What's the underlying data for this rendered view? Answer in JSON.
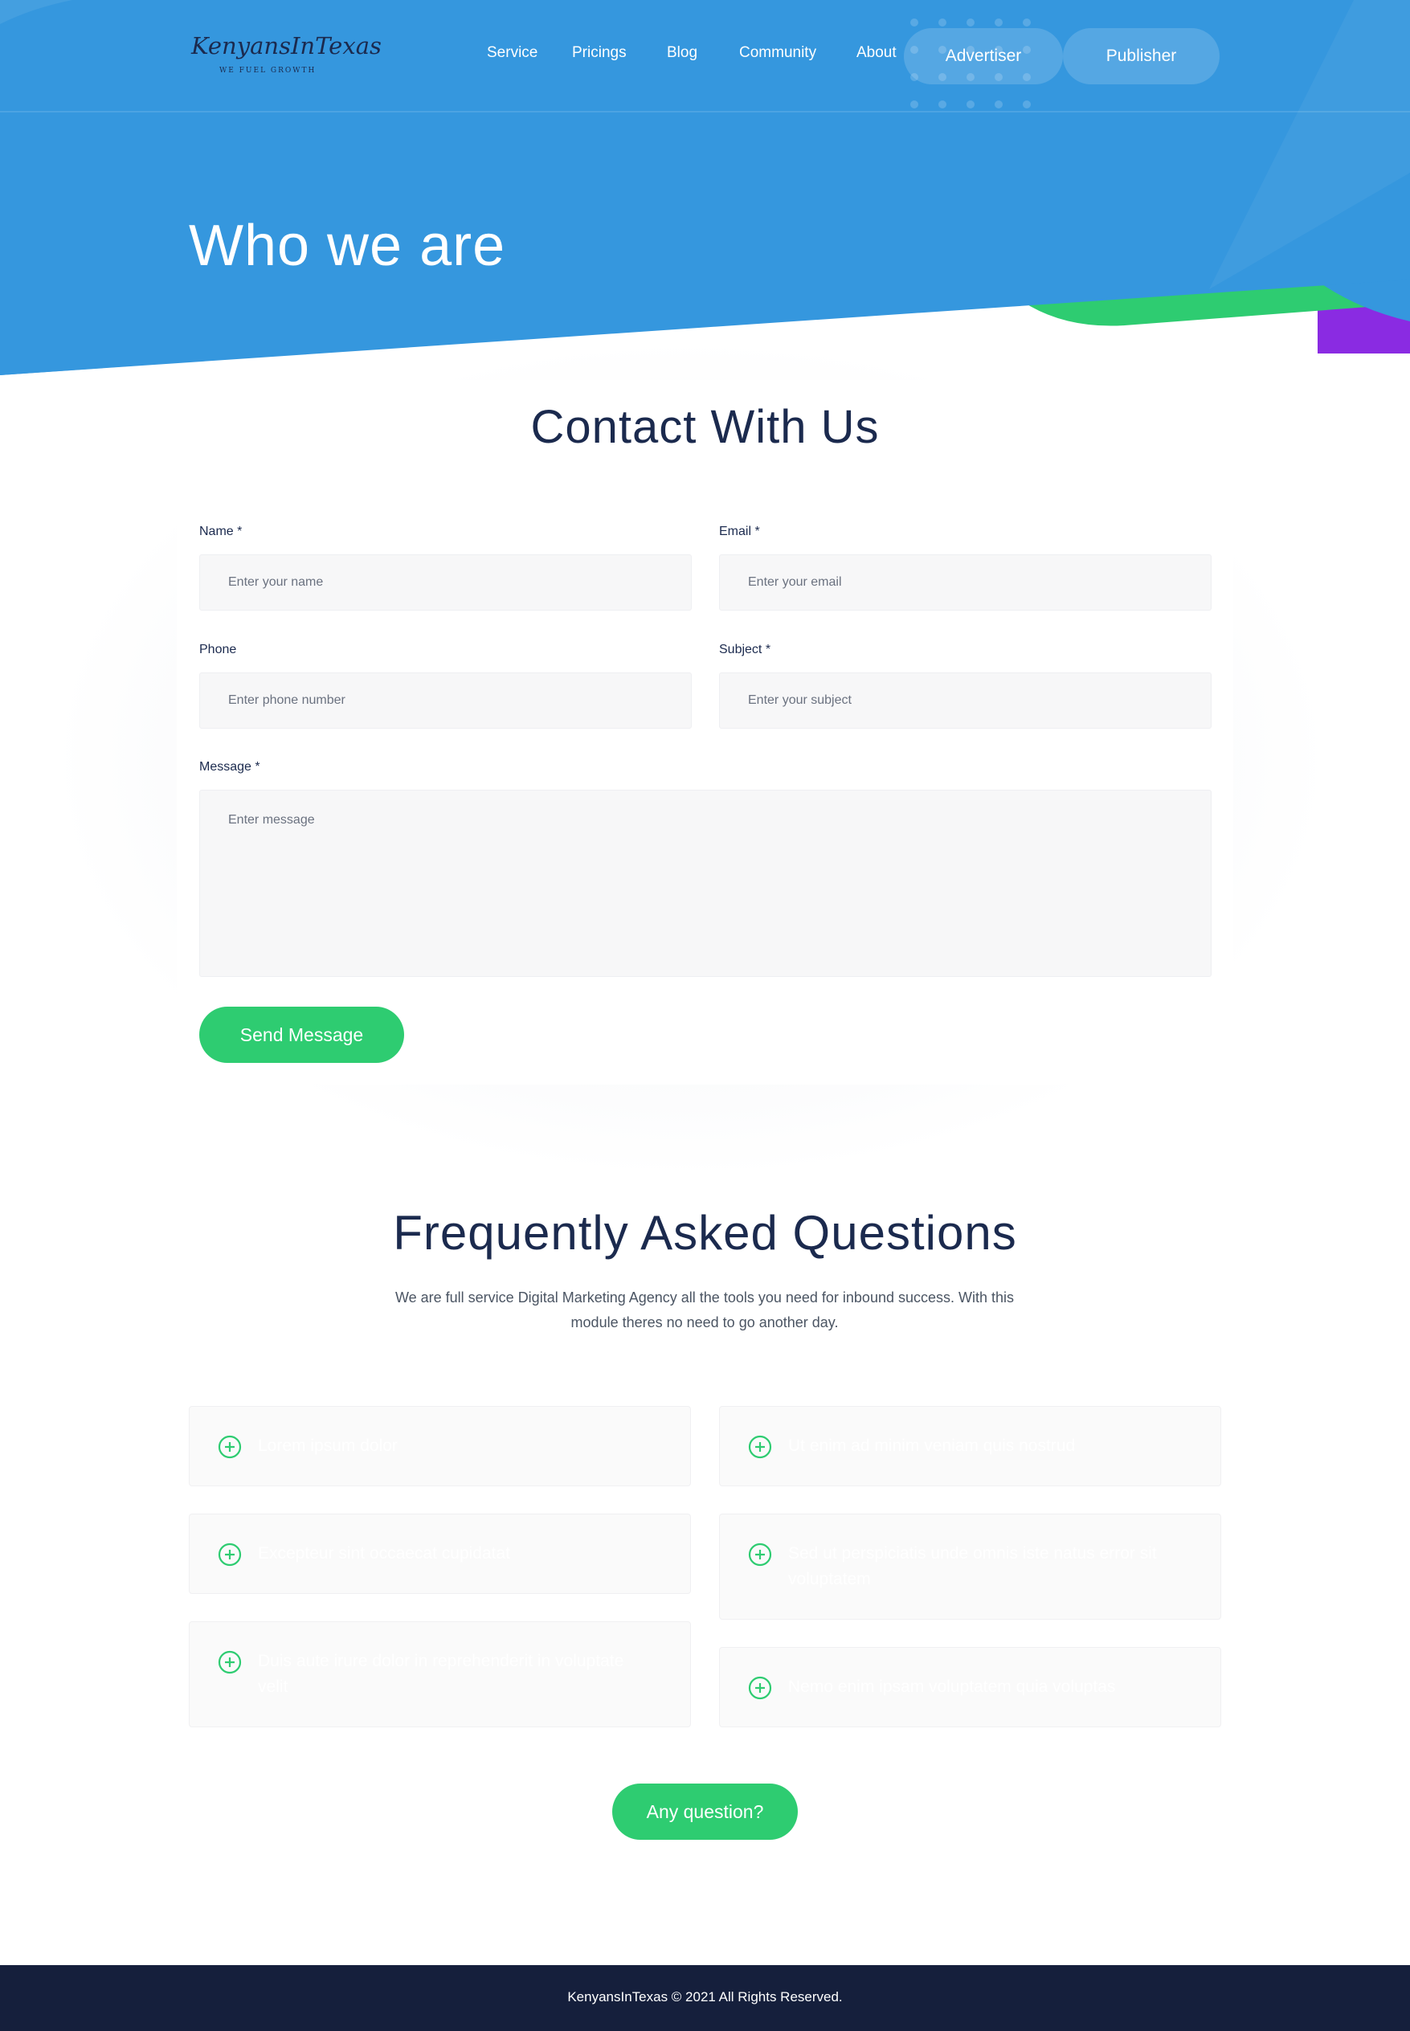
{
  "brand": {
    "logo_script": "KenyansInTexas",
    "logo_tagline": "WE FUEL GROWTH",
    "primary_color": "#3597de",
    "accent_green": "#2ecc71",
    "accent_purple": "#8a2be2",
    "navy": "#1b2a4e"
  },
  "nav": {
    "items": [
      "Service",
      "Pricings",
      "Blog",
      "Community",
      "About"
    ],
    "advertiser_label": "Advertiser",
    "publisher_label": "Publisher"
  },
  "hero": {
    "title": "Who we are"
  },
  "contact": {
    "title": "Contact With Us",
    "name_label": "Name *",
    "name_placeholder": "Enter your name",
    "email_label": "Email *",
    "email_placeholder": "Enter your email",
    "phone_label": "Phone",
    "phone_placeholder": "Enter phone number",
    "subject_label": "Subject *",
    "subject_placeholder": "Enter your subject",
    "message_label": "Message *",
    "message_placeholder": "Enter message",
    "submit_label": "Send Message"
  },
  "faq": {
    "title": "Frequently Asked Questions",
    "description": "We are full service Digital Marketing Agency all the tools you need for inbound success. With this module theres no need to go another day.",
    "left": [
      "Lorem ipsum dolor",
      "Excepteur sint occaecat cupidatat",
      "Duis aute irure dolor in reprehenderit in voluptate velit"
    ],
    "right": [
      "Ut enim ad minim veniam quis nostrud",
      "Sed ut perspiciatis unde omnis iste natus error sit voluptatem",
      "Nemo enim ipsam voluptatem quia voluptas"
    ],
    "cta_label": "Any question?"
  },
  "footer": {
    "copyright": "KenyansInTexas © 2021 All Rights Reserved."
  }
}
